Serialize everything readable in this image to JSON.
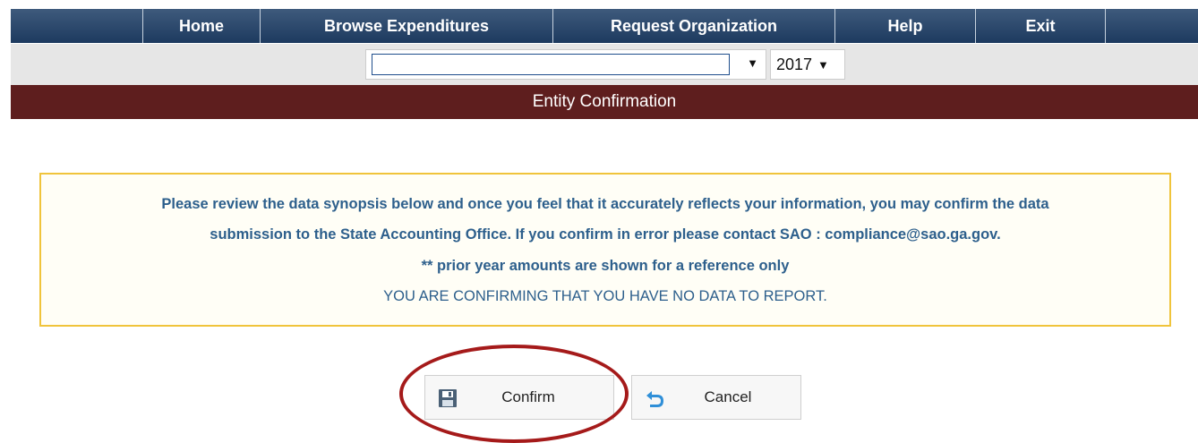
{
  "nav": {
    "items": [
      {
        "label": "Home"
      },
      {
        "label": "Browse Expenditures"
      },
      {
        "label": "Request Organization"
      },
      {
        "label": "Help"
      },
      {
        "label": "Exit"
      }
    ]
  },
  "selector": {
    "entity_value": "",
    "year_value": "2017"
  },
  "titlebar": {
    "title": "Entity Confirmation"
  },
  "notice": {
    "line1": "Please review the data synopsis below and once you feel that it accurately reflects your information, you may confirm the data",
    "line2": "submission to the State Accounting Office. If you confirm in error please contact SAO : compliance@sao.ga.gov.",
    "line3": "** prior year amounts are shown for a reference only",
    "line4": "YOU ARE CONFIRMING THAT YOU HAVE NO DATA TO REPORT."
  },
  "buttons": {
    "confirm_label": "Confirm",
    "cancel_label": "Cancel"
  },
  "icons": {
    "confirm": "save-icon",
    "cancel": "undo-arrow-icon",
    "dropdown": "caret-down-icon"
  },
  "colors": {
    "nav_bg": "#1d3a5f",
    "title_bg": "#5e1e1e",
    "notice_border": "#f0c43b",
    "notice_text": "#2d5f8c",
    "highlight": "#a51a1a"
  }
}
